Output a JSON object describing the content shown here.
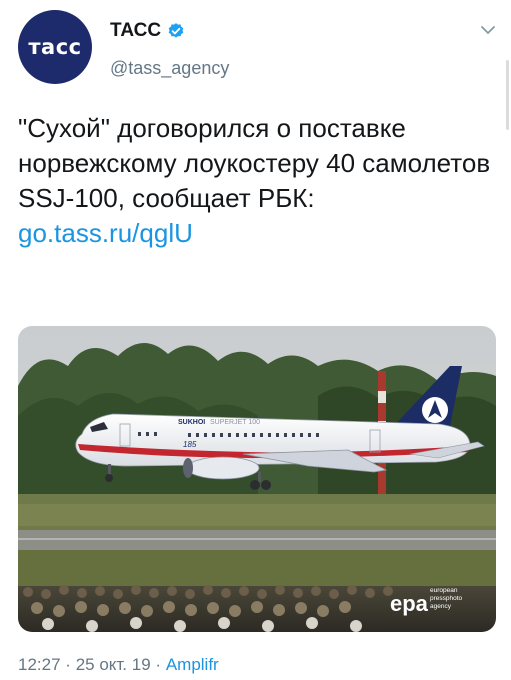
{
  "account": {
    "avatar_text": "тасс",
    "display_name": "ТАСС",
    "handle": "@tass_agency",
    "verified": true
  },
  "tweet": {
    "text": "\"Сухой\" договорился о поставке норвежскому лоукостеру 40 самолетов SSJ-100, сообщает РБК:",
    "link": "go.tass.ru/qglU"
  },
  "media": {
    "aircraft_brand": "SUKHOI",
    "aircraft_model": "SUPERJET 100",
    "tail_number": "185",
    "watermark_logo": "epa",
    "watermark_text": [
      "european",
      "pressphoto",
      "agency"
    ]
  },
  "meta": {
    "time": "12:27",
    "separator": "·",
    "date": "25 окт. 19",
    "source": "Amplifr"
  },
  "colors": {
    "link": "#1b95e0",
    "verified": "#1da1f2",
    "avatar_bg": "#1d2a6b",
    "muted": "#657786"
  },
  "icons": [
    "verified-badge-icon",
    "chevron-down-icon"
  ]
}
